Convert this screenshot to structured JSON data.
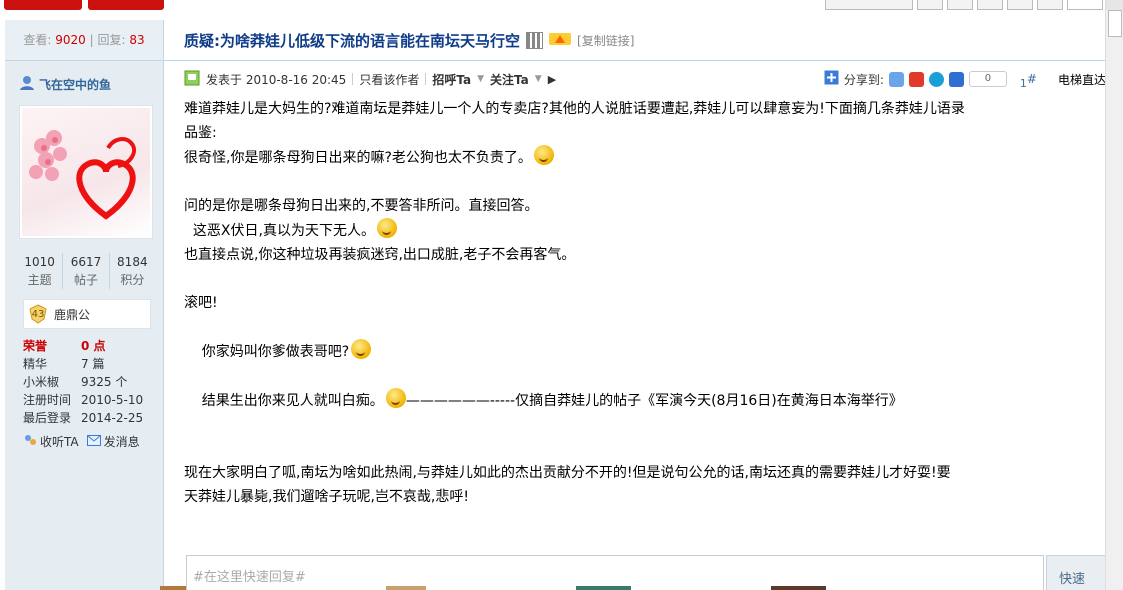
{
  "colors": {
    "accent_title": "#0f3c88",
    "highlight_red": "#cc0000",
    "sidebar_bg": "#e5edf2",
    "border": "#c2d5e3"
  },
  "thread": {
    "views_label": "查看:",
    "views": "9020",
    "divider": "|",
    "replies_label": "回复:",
    "replies": "83",
    "title": "质疑:为啥莽娃儿低级下流的语言能在南坛天马行空",
    "copy_link": "[复制链接]"
  },
  "author": {
    "name": "飞在空中的鱼",
    "counts": [
      {
        "value": "1010",
        "label": "主题"
      },
      {
        "value": "6617",
        "label": "帖子"
      },
      {
        "value": "8184",
        "label": "积分"
      }
    ],
    "level": "43",
    "group": "鹿鼎公",
    "info": [
      {
        "key": "荣誉",
        "value": "0 点",
        "highlight": true
      },
      {
        "key": "精华",
        "value": "7 篇"
      },
      {
        "key": "小米椒",
        "value": "9325 个"
      },
      {
        "key": "注册时间",
        "value": "2010-5-10"
      },
      {
        "key": "最后登录",
        "value": "2014-2-25"
      }
    ],
    "actions": {
      "follow": "收听TA",
      "message": "发消息"
    }
  },
  "post_meta": {
    "posted": "发表于 2010-8-16 20:45",
    "only_author": "只看该作者",
    "greet": "招呼Ta",
    "follow": "关注Ta",
    "share_label": "分享到:",
    "share_count": "0",
    "floor_num": "1",
    "floor_hash": "#",
    "elevator": "电梯直达"
  },
  "post": {
    "lines": [
      "难道莽娃儿是大妈生的?难道南坛是莽娃儿一个人的专卖店?其他的人说脏话要遭起,莽娃儿可以肆意妄为!下面摘几条莽娃儿语录",
      "品鉴:",
      "很奇怪,你是哪条母狗日出来的嘛?老公狗也太不负责了。",
      "",
      "问的是你是哪条母狗日出来的,不要答非所问。直接回答。",
      "  这恶X伏日,真以为天下无人。",
      "也直接点说,你这种垃圾再装疯迷窍,出口成脏,老子不会再客气。",
      "",
      "滚吧!",
      "",
      "    你家妈叫你爹做表哥吧?",
      "",
      "    结果生出你来见人就叫白痴。",
      "",
      "",
      "现在大家明白了呱,南坛为啥如此热闹,与莽娃儿如此的杰出贡献分不开的!但是说句公允的话,南坛还真的需要莽娃儿才好耍!要",
      "天莽娃儿暴毙,我们遛啥子玩呢,岂不哀哉,悲呼!"
    ],
    "quote_dash": "——————-----",
    "quote_text": "仅摘自莽娃儿的帖子《军演今天(8月16日)在黄海日本海举行》"
  },
  "reply": {
    "placeholder": "#在这里快速回复#",
    "button": "快速"
  }
}
